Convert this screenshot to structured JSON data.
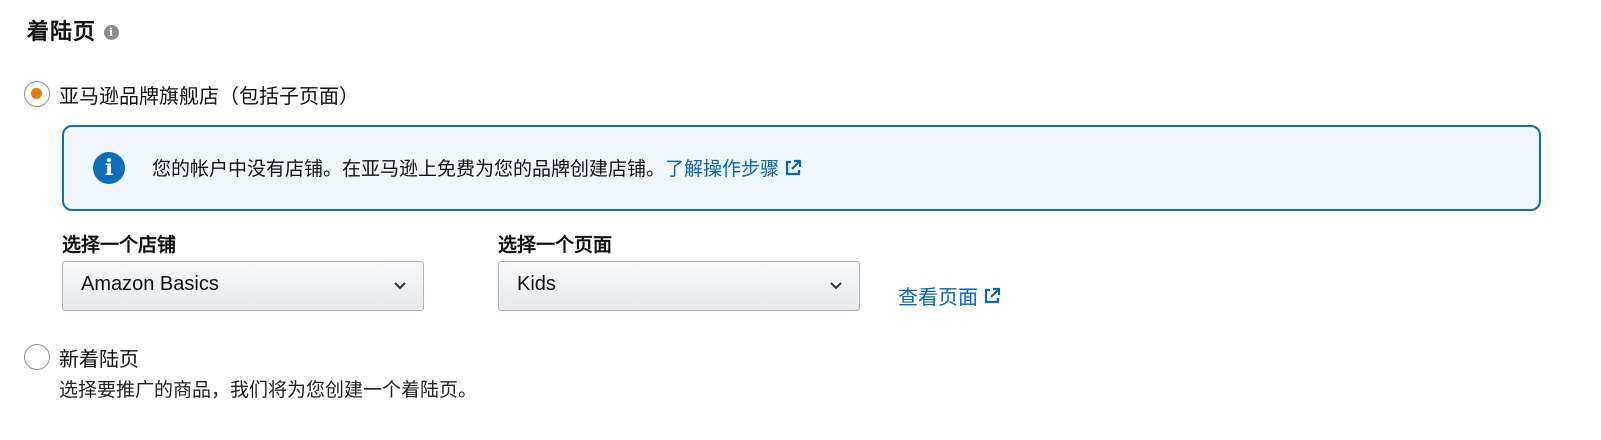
{
  "section": {
    "title": "着陆页",
    "info_icon": "info-circle-icon"
  },
  "store_option": {
    "label": "亚马逊品牌旗舰店（包括子页面）",
    "checked": true
  },
  "alert": {
    "icon": "info-icon",
    "message": "您的帐户中没有店铺。在亚马逊上免费为您的品牌创建店铺。",
    "link_text": "了解操作步骤"
  },
  "store_select": {
    "label": "选择一个店铺",
    "value": "Amazon Basics"
  },
  "page_select": {
    "label": "选择一个页面",
    "value": "Kids"
  },
  "view_page_link": "查看页面",
  "new_option": {
    "label": "新着陆页",
    "description": "选择要推广的商品，我们将为您创建一个着陆页。",
    "checked": false
  },
  "colors": {
    "accent_orange": "#e47911",
    "link_blue": "#0066c0",
    "alert_border": "#0a6ebd",
    "alert_bg": "#f0f6fc"
  }
}
